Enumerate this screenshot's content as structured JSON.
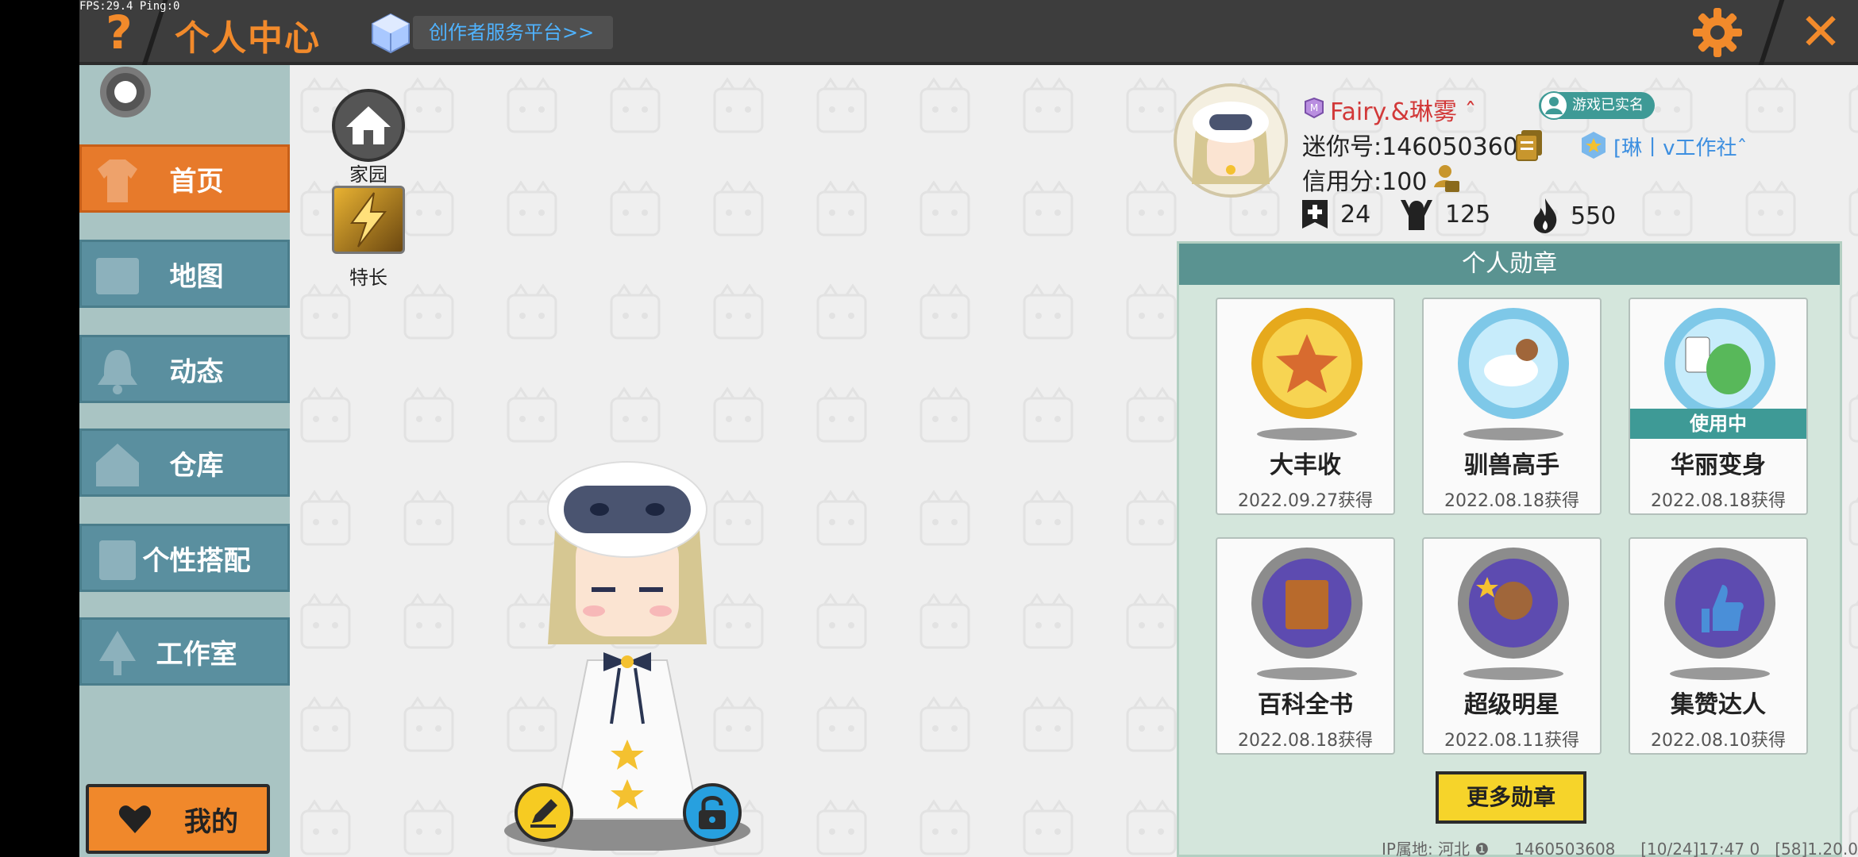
{
  "debug": {
    "fps": "FPS:29.4  Ping:0"
  },
  "header": {
    "title": "个人中心",
    "creator_link": "创作者服务平台>>",
    "help_symbol": "?",
    "close_symbol": "✕",
    "colors": {
      "accent": "#f28a2b",
      "link": "#4fb3ff",
      "bar": "#3d3d3d"
    }
  },
  "sidebar": {
    "items": [
      {
        "label": "首页",
        "icon": "shirt-icon",
        "active": true
      },
      {
        "label": "地图",
        "icon": "map-icon",
        "active": false
      },
      {
        "label": "动态",
        "icon": "bell-icon",
        "active": false
      },
      {
        "label": "仓库",
        "icon": "house-icon",
        "active": false
      },
      {
        "label": "个性搭配",
        "icon": "outfit-icon",
        "active": false
      },
      {
        "label": "工作室",
        "icon": "tree-icon",
        "active": false
      }
    ],
    "mine_label": "我的"
  },
  "shortcuts": {
    "home_label": "家园",
    "skill_label": "特长"
  },
  "profile": {
    "nickname": "Fairy.&琳雾 ˆ",
    "realname_badge": "游戏已实名",
    "mini_id": "迷你号:1460503608",
    "studio": "[琳丨v工作社ˆ",
    "credit": "信用分:100",
    "friends_count": "24",
    "fans_count": "125",
    "popularity": "550"
  },
  "medals": {
    "header": "个人勋章",
    "items": [
      {
        "name": "大丰收",
        "date": "2022.09.27获得",
        "icon": "gold-medal-icon",
        "in_use": false
      },
      {
        "name": "驯兽高手",
        "date": "2022.08.18获得",
        "icon": "unicorn-medal-icon",
        "in_use": false
      },
      {
        "name": "华丽变身",
        "date": "2022.08.18获得",
        "icon": "dino-medal-icon",
        "in_use": true
      },
      {
        "name": "百科全书",
        "date": "2022.08.18获得",
        "icon": "book-medal-icon",
        "in_use": false
      },
      {
        "name": "超级明星",
        "date": "2022.08.11获得",
        "icon": "star-medal-icon",
        "in_use": false
      },
      {
        "name": "集赞达人",
        "date": "2022.08.10获得",
        "icon": "thumb-medal-icon",
        "in_use": false
      }
    ],
    "in_use_label": "使用中",
    "more_label": "更多勋章"
  },
  "footer": {
    "ip": "IP属地: 河北",
    "uid": "1460503608",
    "time": "[10/24]17:47 0",
    "version": "[58]1.20.0"
  }
}
